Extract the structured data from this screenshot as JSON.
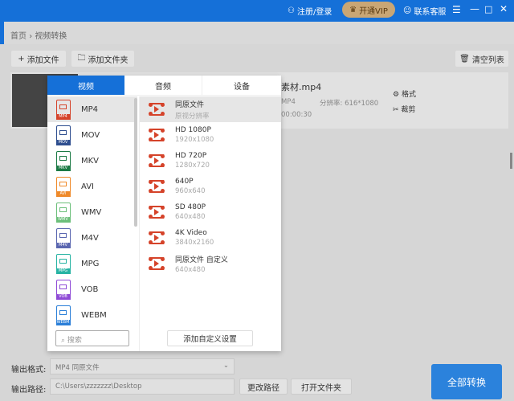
{
  "titlebar": {
    "login": "注册/登录",
    "vip": "开通VIP",
    "service": "联系客服"
  },
  "breadcrumb": {
    "home": "首页",
    "sep": "›",
    "current": "视频转换"
  },
  "toolbar": {
    "add_file": "添加文件",
    "add_folder": "添加文件夹",
    "clear_list": "清空列表"
  },
  "file": {
    "name": "素材.mp4",
    "format": "MP4",
    "resolution": "分辨率: 616*1080",
    "duration": "00:00:30",
    "format_btn": "格式",
    "trim_btn": "裁剪"
  },
  "popup": {
    "tabs": [
      "视频",
      "音频",
      "设备"
    ],
    "formats": [
      {
        "name": "MP4",
        "color": "#d5432a"
      },
      {
        "name": "MOV",
        "color": "#2e4e8f"
      },
      {
        "name": "MKV",
        "color": "#1c7a45"
      },
      {
        "name": "AVI",
        "color": "#ef8a2a"
      },
      {
        "name": "WMV",
        "color": "#6cbf7a"
      },
      {
        "name": "M4V",
        "color": "#5a66b0"
      },
      {
        "name": "MPG",
        "color": "#27b3a3"
      },
      {
        "name": "VOB",
        "color": "#8f4bd6"
      },
      {
        "name": "WEBM",
        "color": "#2b7fd8"
      }
    ],
    "presets": [
      {
        "name": "同原文件",
        "sub": "原视分辨率"
      },
      {
        "name": "HD 1080P",
        "sub": "1920x1080"
      },
      {
        "name": "HD 720P",
        "sub": "1280x720"
      },
      {
        "name": "640P",
        "sub": "960x640"
      },
      {
        "name": "SD 480P",
        "sub": "640x480"
      },
      {
        "name": "4K Video",
        "sub": "3840x2160"
      },
      {
        "name": "同原文件 自定义",
        "sub": "640x480"
      }
    ],
    "search_placeholder": "搜索",
    "custom_btn": "添加自定义设置"
  },
  "bottom": {
    "format_label": "输出格式:",
    "format_value": "MP4  同原文件",
    "path_label": "输出路径:",
    "path_value": "C:\\Users\\zzzzzzz\\Desktop",
    "change_path": "更改路径",
    "open_folder": "打开文件夹",
    "convert_all": "全部转换"
  }
}
